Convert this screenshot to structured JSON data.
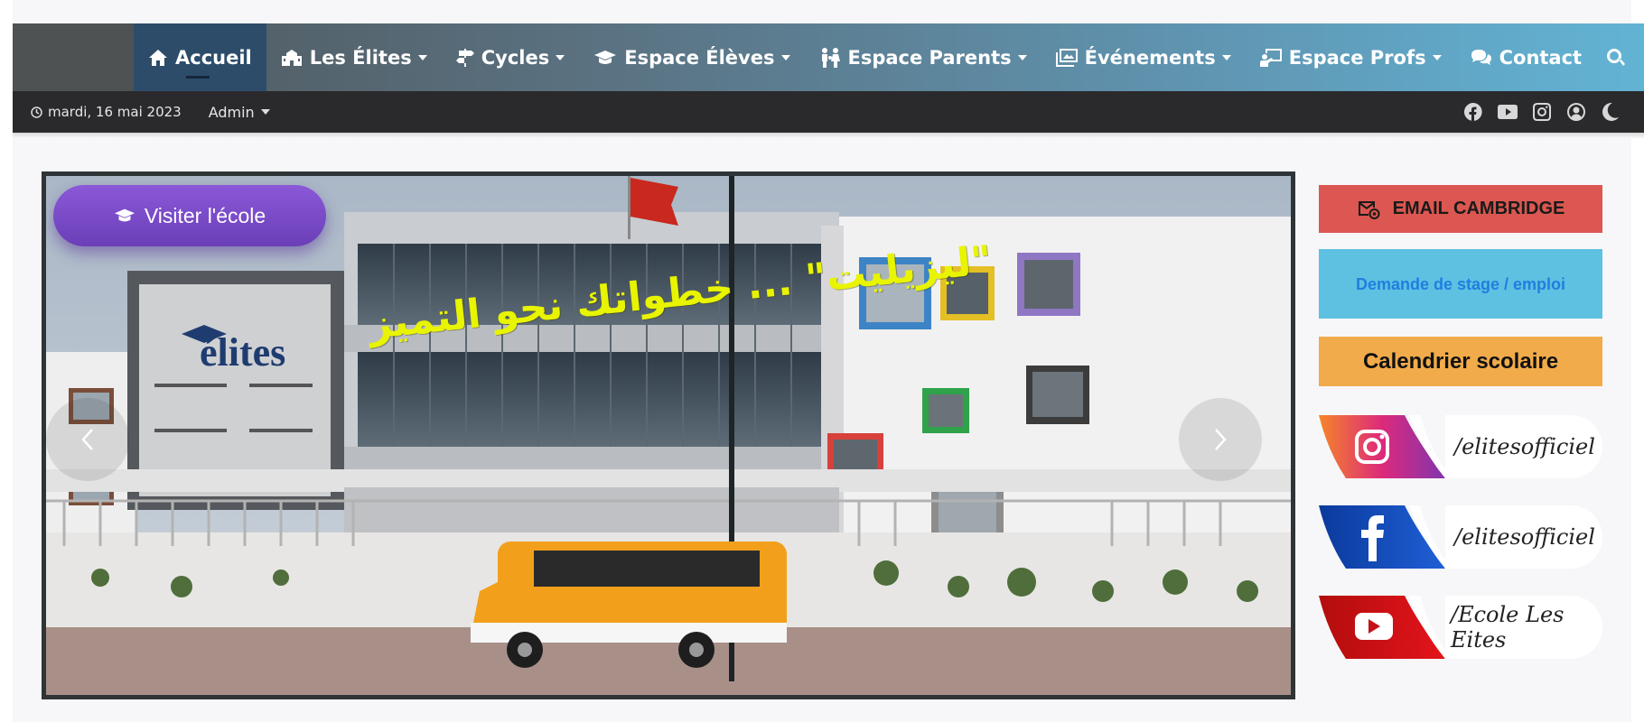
{
  "nav": {
    "items": [
      {
        "label": "Accueil",
        "icon": "home-icon",
        "active": true,
        "dropdown": false
      },
      {
        "label": "Les Élites",
        "icon": "school-icon",
        "active": false,
        "dropdown": true
      },
      {
        "label": "Cycles",
        "icon": "signpost-icon",
        "active": false,
        "dropdown": true
      },
      {
        "label": "Espace Élèves",
        "icon": "graduation-cap-icon",
        "active": false,
        "dropdown": true
      },
      {
        "label": "Espace Parents",
        "icon": "parents-icon",
        "active": false,
        "dropdown": true
      },
      {
        "label": "Événements",
        "icon": "photos-icon",
        "active": false,
        "dropdown": true
      },
      {
        "label": "Espace Profs",
        "icon": "teacher-icon",
        "active": false,
        "dropdown": true
      },
      {
        "label": "Contact",
        "icon": "comments-icon",
        "active": false,
        "dropdown": false
      }
    ],
    "search_icon": "search-icon"
  },
  "subbar": {
    "date": "mardi, 16 mai 2023",
    "admin_label": "Admin",
    "social_icons": [
      "facebook-icon",
      "youtube-icon",
      "instagram-icon",
      "user-icon",
      "moon-icon"
    ]
  },
  "slider": {
    "visit_label": "Visiter l'école",
    "headline": "\"ليزيليت\" ... خطواتك نحو التميز"
  },
  "sidebar": {
    "email_label": "EMAIL CAMBRIDGE",
    "stage_label": "Demande de stage / emploi",
    "calendar_label": "Calendrier scolaire",
    "instagram_handle": "/elitesofficiel",
    "facebook_handle": "/elitesofficiel",
    "youtube_handle": "/Ecole Les Eites"
  },
  "colors": {
    "email": "#dc5751",
    "stage": "#5fc1e1",
    "calendar": "#f1ab4b",
    "visit_button": "#7a4ac8",
    "headline": "#e8f400"
  }
}
